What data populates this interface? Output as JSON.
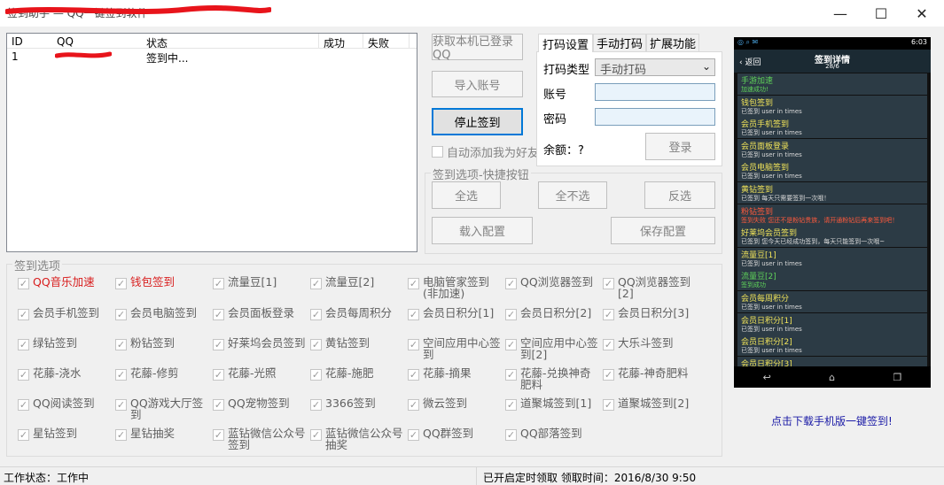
{
  "window": {
    "title": "签到助手 — QQ一键签到软件",
    "controls": {
      "minimize": "—",
      "maximize": "☐",
      "close": "✕"
    }
  },
  "list": {
    "columns": [
      "ID",
      "QQ",
      "状态",
      "成功",
      "失败"
    ],
    "rows": [
      {
        "id": "1",
        "qq": "",
        "status": "签到中..."
      }
    ]
  },
  "left_buttons": {
    "get_logged_qq": "获取本机已登录QQ",
    "import_accounts": "导入账号",
    "stop_signin": "停止签到",
    "auto_add_friend": "自动添加我为好友"
  },
  "quick": {
    "title": "签到选项-快捷按钮",
    "select_all": "全选",
    "select_none": "全不选",
    "invert": "反选",
    "load_config": "载入配置",
    "save_config": "保存配置"
  },
  "tabs": {
    "items": [
      "打码设置",
      "手动打码",
      "扩展功能"
    ],
    "active": 0,
    "captcha_type_label": "打码类型",
    "captcha_type_value": "手动打码",
    "account_label": "账号",
    "password_label": "密码",
    "balance_label": "余额：?",
    "login": "登录"
  },
  "options": {
    "title": "签到选项",
    "rows": [
      [
        {
          "label": "QQ音乐加速",
          "red": true
        },
        {
          "label": "钱包签到",
          "red": true
        },
        {
          "label": "流量豆[1]"
        },
        {
          "label": "流量豆[2]"
        },
        {
          "label": "电脑管家签到(非加速)"
        },
        {
          "label": "QQ浏览器签到"
        },
        {
          "label": "QQ浏览器签到[2]"
        }
      ],
      [
        {
          "label": "会员手机签到"
        },
        {
          "label": "会员电脑签到"
        },
        {
          "label": "会员面板登录"
        },
        {
          "label": "会员每周积分"
        },
        {
          "label": "会员日积分[1]"
        },
        {
          "label": "会员日积分[2]"
        },
        {
          "label": "会员日积分[3]"
        }
      ],
      [
        {
          "label": "绿钻签到"
        },
        {
          "label": "粉钻签到"
        },
        {
          "label": "好莱坞会员签到"
        },
        {
          "label": "黄钻签到"
        },
        {
          "label": "空间应用中心签到"
        },
        {
          "label": "空间应用中心签到[2]"
        },
        {
          "label": "大乐斗签到"
        }
      ],
      [
        {
          "label": "花藤-浇水"
        },
        {
          "label": "花藤-修剪"
        },
        {
          "label": "花藤-光照"
        },
        {
          "label": "花藤-施肥"
        },
        {
          "label": "花藤-摘果"
        },
        {
          "label": "花藤-兑换神奇肥料"
        },
        {
          "label": "花藤-神奇肥料"
        }
      ],
      [
        {
          "label": "QQ阅读签到"
        },
        {
          "label": "QQ游戏大厅签到"
        },
        {
          "label": "QQ宠物签到"
        },
        {
          "label": "3366签到"
        },
        {
          "label": "微云签到"
        },
        {
          "label": "道聚城签到[1]"
        },
        {
          "label": "道聚城签到[2]"
        }
      ],
      [
        {
          "label": "星钻签到"
        },
        {
          "label": "星钻抽奖"
        },
        {
          "label": "蓝钻微信公众号签到"
        },
        {
          "label": "蓝钻微信公众号抽奖"
        },
        {
          "label": "QQ群签到"
        },
        {
          "label": "QQ部落签到"
        }
      ]
    ]
  },
  "phone": {
    "time": "6:03",
    "back": "返回",
    "header_title": "签到详情",
    "header_sub": "28/6",
    "items": [
      {
        "title": "手游加速",
        "sub": "加速成功!",
        "green": true
      },
      {
        "title": "钱包签到",
        "sub": "已签到 user in times"
      },
      {
        "title": "会员手机签到",
        "sub": "已签到 user in times"
      },
      {
        "title": "会员面板登录",
        "sub": "已签到 user in times"
      },
      {
        "title": "会员电脑签到",
        "sub": "已签到 user in times"
      },
      {
        "title": "黄钻签到",
        "sub": "已签到 每天只需要签到一次哦！"
      },
      {
        "title": "粉钻签到",
        "sub": "签到失败 您还不是粉钻贵族，请开通粉钻后再来签到吧！",
        "red": true
      },
      {
        "title": "好莱坞会员签到",
        "sub": "已签到 您今天已经成功签到，每天只能签到一次哦~"
      },
      {
        "title": "流量豆[1]",
        "sub": "已签到 user in times"
      },
      {
        "title": "流量豆[2]",
        "sub": "签到成功",
        "green": true
      },
      {
        "title": "会员每周积分",
        "sub": "已签到 user in times"
      },
      {
        "title": "会员日积分[1]",
        "sub": "已签到 user in times"
      },
      {
        "title": "会员日积分[2]",
        "sub": "已签到 user in times"
      },
      {
        "title": "会员日积分[3]",
        "sub": ""
      }
    ]
  },
  "download_link": "点击下载手机版一键签到!",
  "status": {
    "work_state": "工作状态：工作中",
    "timer": "已开启定时领取 领取时间：2016/8/30 9:50"
  },
  "colors": {
    "red_label": "#d81d1d",
    "link_blue": "#1a1aa6",
    "scribble_red": "#e8141b"
  }
}
